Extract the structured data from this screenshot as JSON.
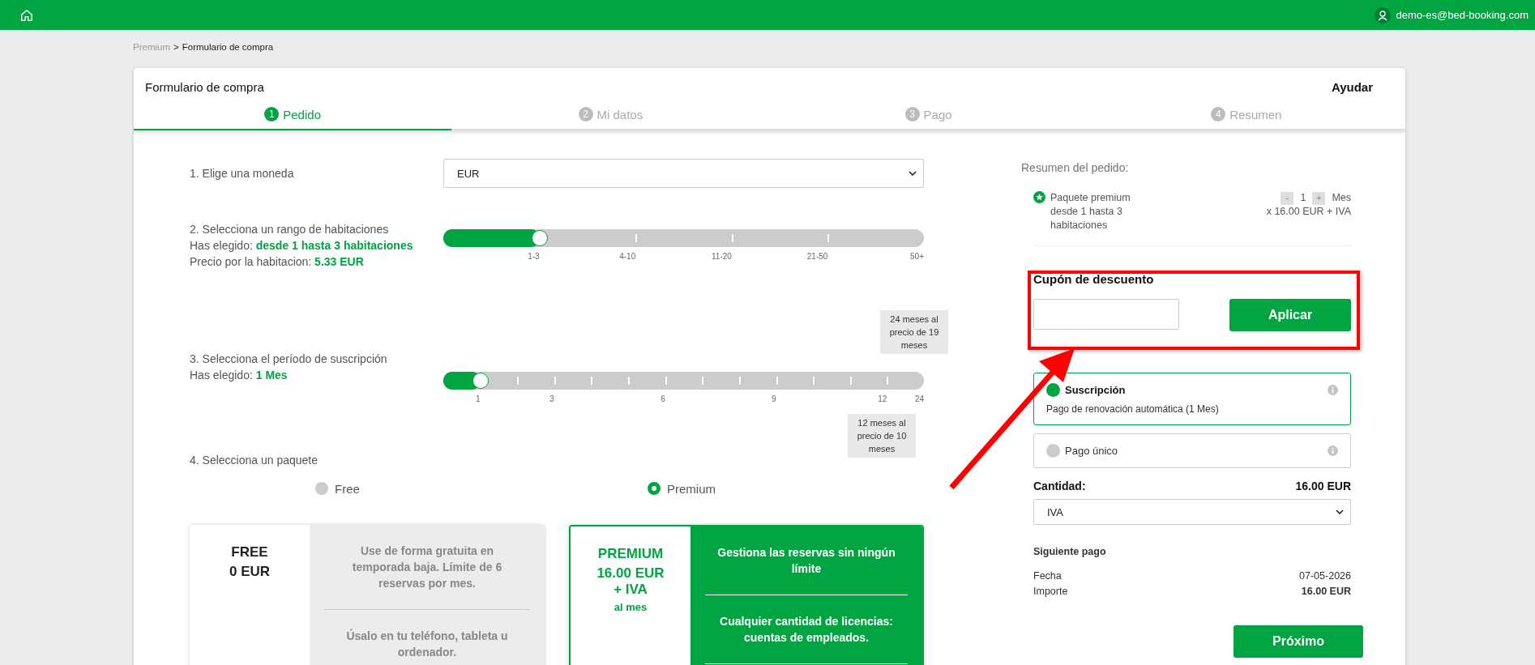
{
  "top_bar": {
    "user": "demo-es@bed-booking.com"
  },
  "breadcrumb": [
    {
      "label": "Premium",
      "link": true
    },
    {
      "label": ">",
      "link": false
    },
    {
      "label": "Formulario de compra",
      "link": false
    }
  ],
  "card": {
    "title": "Formulario de compra",
    "help": "Ayudar"
  },
  "steps": [
    {
      "number": "1",
      "label": "Pedido",
      "selected": true
    },
    {
      "number": "2",
      "label": "Mi datos",
      "selected": false
    },
    {
      "number": "3",
      "label": "Pago",
      "selected": false
    },
    {
      "number": "4",
      "label": "Resumen",
      "selected": false
    }
  ],
  "currency": {
    "label": "1. Elige una moneda",
    "value": "EUR"
  },
  "rooms": {
    "label": "2. Selecciona un rango de habitaciones",
    "chosen_prefix": "Has elegido:",
    "chosen": "desde 1 hasta 3 habitaciones",
    "price_prefix": "Precio por la habitacion:",
    "price": "5.33 EUR",
    "level": 0.2,
    "ticks": [
      "1-3",
      "4-10",
      "11-20",
      "21-50",
      "50+"
    ]
  },
  "period": {
    "label": "3. Selecciona el período de suscripción",
    "chosen_prefix": "Has elegido:",
    "chosen": "1 Mes",
    "level": 0.077,
    "ticks": [
      "1",
      "3",
      "6",
      "9",
      "12",
      "24"
    ],
    "tip_above": "24 meses al precio de 19 meses",
    "tip_below": "12 meses al precio de 10 meses"
  },
  "package": {
    "label": "4. Selecciona un paquete",
    "options": [
      {
        "label": "Free",
        "selected": false
      },
      {
        "label": "Premium",
        "selected": true
      }
    ]
  },
  "plans": [
    {
      "name": "FREE",
      "price": "0 EUR",
      "selected": false,
      "features": [
        "Use de forma gratuita en temporada baja. Límite de 6 reservas por mes.",
        "Úsalo en tu teléfono, tableta u ordenador."
      ]
    },
    {
      "name": "PREMIUM",
      "price": "16.00 EUR + IVA",
      "per": "al mes",
      "selected": true,
      "features": [
        "Gestiona las reservas sin ningún límite",
        "Cualquier cantidad de licencias: cuentas de empleados."
      ]
    }
  ],
  "summary": {
    "title": "Resumen del pedido:",
    "package": "Paquete premium desde 1 hasta 3 habitaciones",
    "minus": "-",
    "qty": "1",
    "plus": "+",
    "unit": "Mes",
    "price": "x 16.00 EUR + IVA",
    "coupon_label": "Cupón de descuento",
    "apply": "Aplicar",
    "payment": [
      {
        "title": "Suscripción",
        "desc": "Pago de renovación automática (1 Mes)",
        "selected": true
      },
      {
        "title": "Pago único",
        "selected": false
      }
    ],
    "amount_label": "Cantidad:",
    "amount": "16.00 EUR",
    "tax": "IVA"
  },
  "next_payment": {
    "title": "Siguiente pago",
    "rows": [
      {
        "label": "Fecha",
        "value": "07-05-2026",
        "bold": false
      },
      {
        "label": "Importe",
        "value": "16.00 EUR",
        "bold": true
      }
    ]
  },
  "next_button": "Próximo"
}
